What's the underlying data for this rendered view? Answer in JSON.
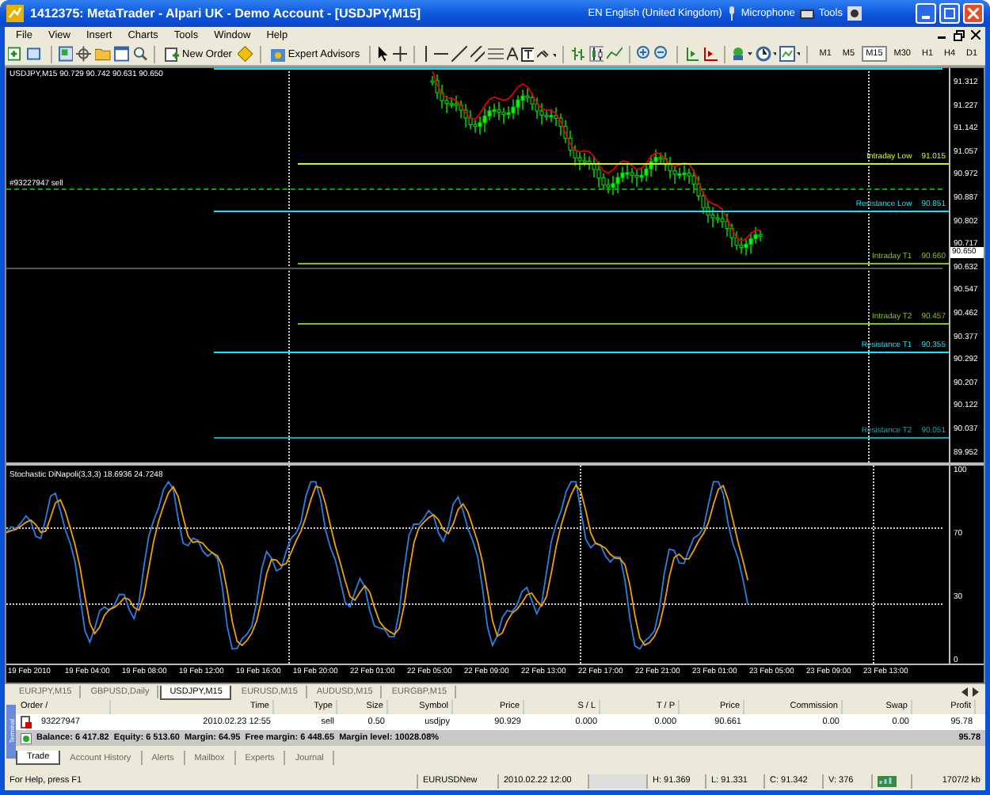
{
  "window": {
    "title": "1412375: MetaTrader - Alpari UK - Demo Account - [USDJPY,M15]"
  },
  "language_bar": {
    "language": "EN English (United Kingdom)",
    "microphone": "Microphone",
    "tools": "Tools"
  },
  "menu": [
    "File",
    "View",
    "Insert",
    "Charts",
    "Tools",
    "Window",
    "Help"
  ],
  "toolbar": {
    "new_order": "New Order",
    "expert_advisors": "Expert Advisors",
    "timeframes": [
      {
        "label": "M1",
        "selected": false
      },
      {
        "label": "M5",
        "selected": false
      },
      {
        "label": "M15",
        "selected": true
      },
      {
        "label": "M30",
        "selected": false
      },
      {
        "label": "H1",
        "selected": false
      },
      {
        "label": "H4",
        "selected": false
      },
      {
        "label": "D1",
        "selected": false
      }
    ]
  },
  "chart": {
    "info": "USDJPY,M15 90.729 90.742 90.631 90.650",
    "order_label": "#93227947 sell",
    "current_price": "90.650",
    "price_scale": [
      "91.312",
      "91.227",
      "91.142",
      "91.057",
      "90.972",
      "90.887",
      "90.802",
      "90.717",
      "90.632",
      "90.547",
      "90.462",
      "90.377",
      "90.292",
      "90.207",
      "90.122",
      "90.037",
      "89.952"
    ],
    "levels": [
      {
        "kind": "intraday",
        "label": "Intraday Low",
        "value": "91.015",
        "color": "#c8ff00"
      },
      {
        "kind": "resistance",
        "label": "Resistance Low",
        "value": "90.851",
        "color": "#00e8ff"
      },
      {
        "kind": "intraday",
        "label": "Intraday T1",
        "value": "90.660",
        "color": "#80c800"
      },
      {
        "kind": "intraday",
        "label": "Intraday T2",
        "value": "90.457",
        "color": "#80c800"
      },
      {
        "kind": "resistance",
        "label": "Resistance T1",
        "value": "90.355",
        "color": "#00e8ff"
      },
      {
        "kind": "resistance",
        "label": "Resistance T2",
        "value": "90.051",
        "color": "#00b0b8"
      }
    ],
    "indicator": {
      "title": "Stochastic DiNapoli(3,3,3) 18.6936 24.7248",
      "scale": [
        "100",
        "70",
        "30",
        "0"
      ]
    },
    "time_axis": [
      "19 Feb 2010",
      "19 Feb 04:00",
      "19 Feb 08:00",
      "19 Feb 12:00",
      "19 Feb 16:00",
      "19 Feb 20:00",
      "22 Feb 01:00",
      "22 Feb 05:00",
      "22 Feb 09:00",
      "22 Feb 13:00",
      "22 Feb 17:00",
      "22 Feb 21:00",
      "23 Feb 01:00",
      "23 Feb 05:00",
      "23 Feb 09:00",
      "23 Feb 13:00"
    ]
  },
  "symbol_tabs": [
    {
      "label": "EURJPY,M15",
      "selected": false
    },
    {
      "label": "GBPUSD,Daily",
      "selected": false
    },
    {
      "label": "USDJPY,M15",
      "selected": true
    },
    {
      "label": "EURUSD,M15",
      "selected": false
    },
    {
      "label": "AUDUSD,M15",
      "selected": false
    },
    {
      "label": "EURGBP,M15",
      "selected": false
    }
  ],
  "terminal": {
    "label": "Terminal",
    "columns": [
      "Order /",
      "Time",
      "Type",
      "Size",
      "Symbol",
      "Price",
      "S / L",
      "T / P",
      "Price",
      "Commission",
      "Swap",
      "Profit"
    ],
    "orders": [
      [
        "93227947",
        "2010.02.23 12:55",
        "sell",
        "0.50",
        "usdjpy",
        "90.929",
        "0.000",
        "0.000",
        "90.661",
        "0.00",
        "0.00",
        "95.78"
      ]
    ],
    "summary": {
      "text": "Balance: 6 417.82  Equity: 6 513.60  Margin: 64.95  Free margin: 6 448.65  Margin level: 10028.08%",
      "profit": "95.78"
    },
    "tabs": [
      {
        "label": "Trade",
        "selected": true
      },
      {
        "label": "Account History",
        "selected": false
      },
      {
        "label": "Alerts",
        "selected": false
      },
      {
        "label": "Mailbox",
        "selected": false
      },
      {
        "label": "Experts",
        "selected": false
      },
      {
        "label": "Journal",
        "selected": false
      }
    ]
  },
  "status_bar": {
    "help": "For Help, press F1",
    "profile": "EURUSDNew",
    "time": "2010.02.22 12:00",
    "high": "H: 91.369",
    "low": "L: 91.331",
    "close": "C: 91.342",
    "volume": "V: 376",
    "traffic": "1707/2 kb"
  }
}
